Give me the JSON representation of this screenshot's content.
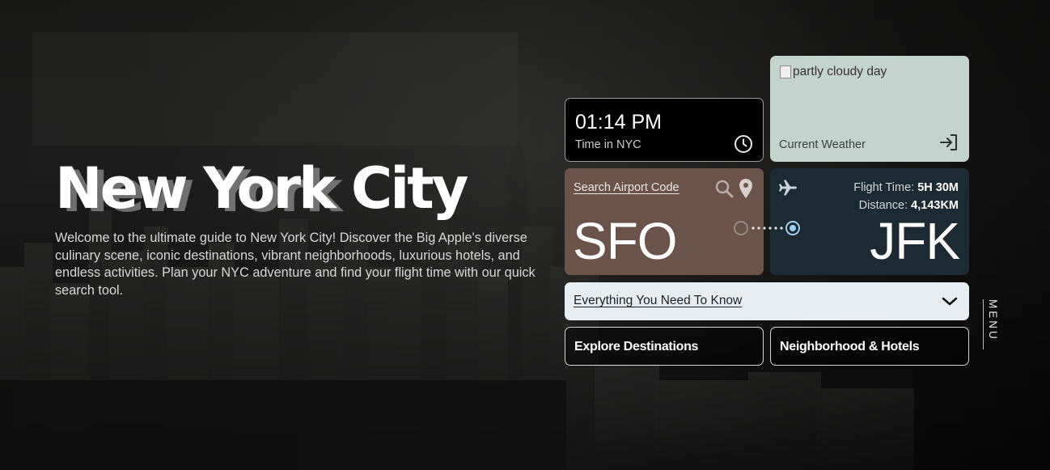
{
  "hero": {
    "title_word1": "New",
    "title_word2": "York",
    "title_word3": "City",
    "description": "Welcome to the ultimate guide to New York City! Discover the Big Apple's diverse culinary scene, iconic destinations, vibrant neighborhoods, luxurious hotels, and endless activities. Plan your NYC adventure and find your flight time with our quick search tool."
  },
  "time_widget": {
    "time": "01:14 PM",
    "label": "Time in NYC",
    "icon": "clock-icon"
  },
  "weather_widget": {
    "image_alt": "partly cloudy day",
    "label": "Current Weather",
    "icon": "login-arrow-icon",
    "background_color": "#c5d3ce"
  },
  "search_widget": {
    "label": "Search Airport Code",
    "from_code": "SFO",
    "icons": [
      "search-icon",
      "map-pin-icon"
    ],
    "background_color": "#6b534a"
  },
  "flight_widget": {
    "flight_time_label": "Flight Time:",
    "flight_time_value": "5H 30M",
    "distance_label": "Distance:",
    "distance_value": "4,143KM",
    "to_code": "JFK",
    "icon": "airplane-icon",
    "background_color": "#1c2a33"
  },
  "accordion": {
    "label": "Everything You Need To Know",
    "icon": "chevron-down-icon"
  },
  "buttons": {
    "explore": "Explore Destinations",
    "neighborhoods": "Neighborhood & Hotels"
  },
  "menu": {
    "label": "MENU"
  }
}
